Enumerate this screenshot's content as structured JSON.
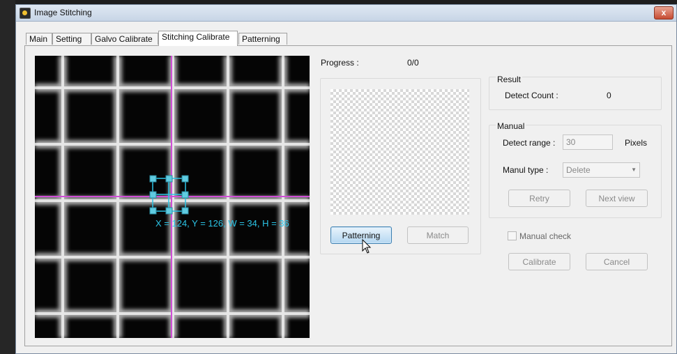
{
  "window": {
    "title": "Image Stitching",
    "close_label": "x"
  },
  "tabs": [
    {
      "label": "Main"
    },
    {
      "label": "Setting"
    },
    {
      "label": "Galvo Calibrate"
    },
    {
      "label": "Stitching Calibrate",
      "active": true
    },
    {
      "label": "Patterning"
    }
  ],
  "camera": {
    "overlay_text": "X = 124, Y = 126, W = 34, H = 36",
    "crosshair_color": "#d04fd6",
    "selection_color": "#2bc4e6"
  },
  "progress": {
    "label": "Progress :",
    "value": "0/0"
  },
  "pattern_buttons": {
    "patterning": "Patterning",
    "match": "Match"
  },
  "result": {
    "group_label": "Result",
    "detect_count_label": "Detect Count :",
    "detect_count_value": "0"
  },
  "manual": {
    "group_label": "Manual",
    "detect_range_label": "Detect range :",
    "detect_range_value": "30",
    "pixels_label": "Pixels",
    "manual_type_label": "Manul type :",
    "manual_type_value": "Delete",
    "retry": "Retry",
    "next_view": "Next view"
  },
  "manual_check_label": "Manual check",
  "footer_buttons": {
    "calibrate": "Calibrate",
    "cancel": "Cancel"
  },
  "icons": {
    "app": "image-stitching-app-icon",
    "close": "close-icon",
    "cursor": "mouse-pointer-icon"
  }
}
